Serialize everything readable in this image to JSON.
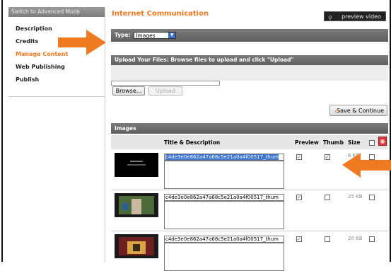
{
  "sidebar": {
    "header": "Switch to Advanced Mode",
    "items": [
      {
        "label": "Description",
        "active": false
      },
      {
        "label": "Credits",
        "active": false
      },
      {
        "label": "Manage Content",
        "active": true
      },
      {
        "label": "Web Publishing",
        "active": false
      },
      {
        "label": "Publish",
        "active": false
      }
    ]
  },
  "main": {
    "title": "Internet Communication",
    "preview_video_label": "preview video",
    "type_label": "Type:",
    "type_value": "Images",
    "upload_bar_text": "Upload Your Files: Browse files to upload and click \"Upload\"",
    "browse_label": "Browse...",
    "upload_label": "Upload",
    "save_continue_label": "Save & Continue",
    "images_section_title": "Images",
    "columns": {
      "title_desc": "Title & Description",
      "preview": "Preview",
      "thumb": "Thumb",
      "size": "Size"
    },
    "rows": [
      {
        "title": "c4de3e0e862a47a68c5e21a0a4f00517_thum",
        "preview": true,
        "thumb": true,
        "size": "6 KB",
        "selected": true
      },
      {
        "title": "c4de3e0e862a47a68c5e21a0a4f00517_thum",
        "preview": true,
        "thumb": false,
        "size": "25 KB",
        "selected": false
      },
      {
        "title": "c4de3e0e862a47a68c5e21a0a4f00517_thum",
        "preview": true,
        "thumb": false,
        "size": "20 KB",
        "selected": false
      }
    ]
  },
  "colors": {
    "accent": "#f07a22",
    "bar": "#6a6a6a",
    "selection": "#3b73d1"
  }
}
